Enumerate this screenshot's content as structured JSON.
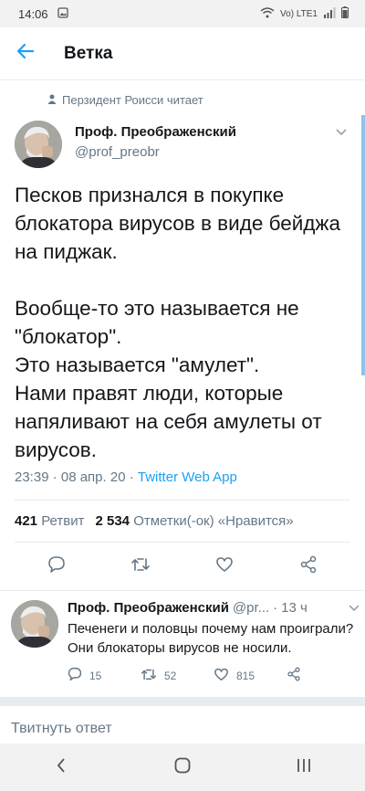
{
  "status": {
    "time": "14:06",
    "network": "Vo) LTE1"
  },
  "header": {
    "title": "Ветка"
  },
  "context": {
    "text": "Перзидент Роисси читает"
  },
  "tweet": {
    "author_name": "Проф. Преображенский",
    "author_handle": "@prof_preobr",
    "text": "Песков признался в покупке блокатора вирусов в виде бейджа на пиджак.\n\nВообще-то это называется не \"блокатор\".\nЭто называется \"амулет\".\nНами правят люди, которые напяливают на себя амулеты от вирусов.",
    "time": "23:39 · 08 апр. 20 ·",
    "source": "Twitter Web App",
    "retweets_count": "421",
    "retweets_label": "Ретвит",
    "likes_count": "2 534",
    "likes_label": "Отметки(-ок) «Нравится»"
  },
  "reply": {
    "author_name": "Проф. Преображенский",
    "author_handle": "@pr...",
    "time": "13 ч",
    "text": "Печенеги и половцы почему нам проиграли?\nОни блокаторы вирусов не носили.",
    "replies": "15",
    "retweets": "52",
    "likes": "815"
  },
  "compose": {
    "placeholder": "Твитнуть ответ"
  },
  "colors": {
    "accent": "#1da1f2",
    "thread_bar": "#8ec3ea",
    "muted": "#657786"
  }
}
